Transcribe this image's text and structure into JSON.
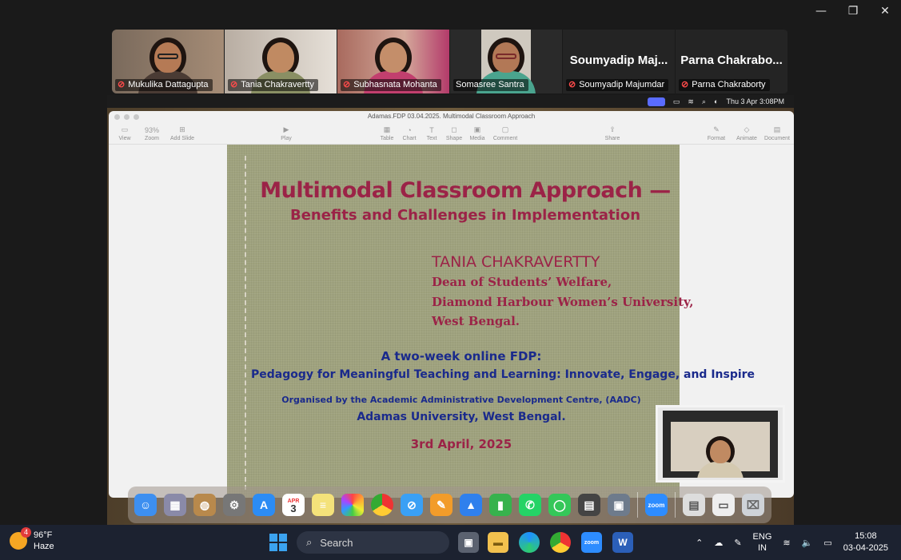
{
  "window": {
    "minimize": "—",
    "restore": "❐",
    "close": "✕"
  },
  "participants": [
    {
      "name": "Mukulika Dattagupta",
      "muted": true
    },
    {
      "name": "Tania Chakravertty",
      "muted": true
    },
    {
      "name": "Subhasnata Mohanta",
      "muted": true
    },
    {
      "name": "Somasree Santra",
      "muted": false,
      "active": true
    },
    {
      "name": "Soumyadip Majumdar",
      "display": "Soumyadip Maj...",
      "muted": true
    },
    {
      "name": "Parna Chakraborty",
      "display": "Parna Chakrabo...",
      "muted": true
    }
  ],
  "mac_menubar": {
    "datetime": "Thu 3 Apr  3:08PM"
  },
  "keynote": {
    "file_title": "Adamas.FDP 03.04.2025. Multimodal Classroom Approach",
    "zoom": "93%",
    "toolbar": {
      "view": "View",
      "zoom": "Zoom",
      "add_slide": "Add Slide",
      "play": "Play",
      "table": "Table",
      "chart": "Chart",
      "text": "Text",
      "shape": "Shape",
      "media": "Media",
      "comment": "Comment",
      "share": "Share",
      "format": "Format",
      "animate": "Animate",
      "document": "Document"
    }
  },
  "slide": {
    "title": "Multimodal Classroom Approach —",
    "subtitle": "Benefits and Challenges in Implementation",
    "presenter": "TANIA CHAKRAVERTTY",
    "role1": "Dean of Students’ Welfare,",
    "role2": "Diamond Harbour Women’s University,",
    "role3": "West Bengal.",
    "fdp_line1": "A two-week online FDP:",
    "fdp_line2": "Pedagogy for Meaningful Teaching and Learning: Innovate, Engage, and Inspire",
    "org_line1": "Organised by the Academic Administrative Development Centre, (AADC)",
    "org_line2": "Adamas University, West Bengal.",
    "date": "3rd April, 2025"
  },
  "dock": {
    "calendar_month": "APR",
    "calendar_day": "3",
    "zoom_label": "zoom"
  },
  "taskbar": {
    "weather_badge": "4",
    "temp": "96°F",
    "condition": "Haze",
    "search_placeholder": "Search",
    "lang1": "ENG",
    "lang2": "IN",
    "time": "15:08",
    "date": "03-04-2025"
  },
  "colors": {
    "slide_maroon": "#9b2347",
    "slide_blue": "#1a2a8c",
    "active_border": "#2ecc71"
  }
}
